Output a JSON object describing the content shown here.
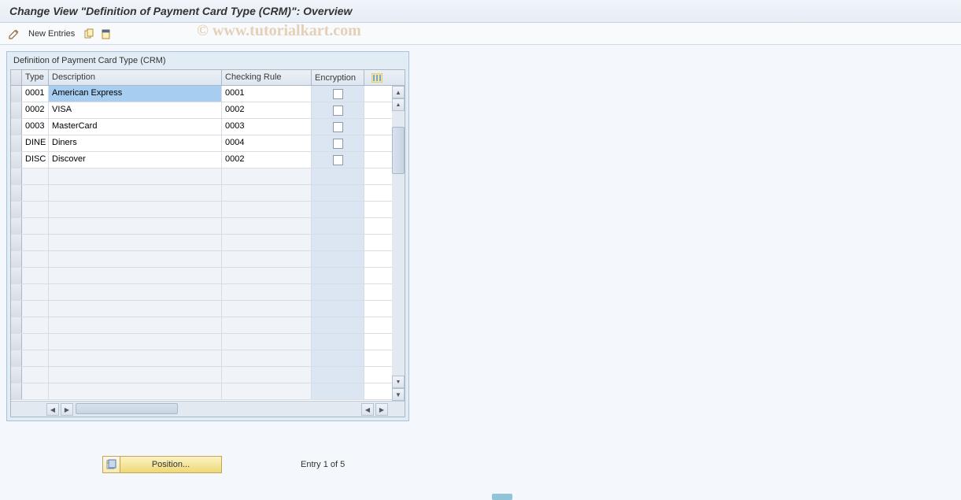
{
  "header": {
    "title": "Change View \"Definition of Payment Card Type (CRM)\": Overview"
  },
  "watermark": "© www.tutorialkart.com",
  "toolbar": {
    "new_entries_label": "New Entries"
  },
  "panel": {
    "title": "Definition of Payment Card Type (CRM)"
  },
  "columns": {
    "type": "Type",
    "description": "Description",
    "checking_rule": "Checking Rule",
    "encryption": "Encryption"
  },
  "rows": [
    {
      "type": "0001",
      "description": "American Express",
      "checking_rule": "0001",
      "encryption": false,
      "selected": true
    },
    {
      "type": "0002",
      "description": "VISA",
      "checking_rule": "0002",
      "encryption": false,
      "selected": false
    },
    {
      "type": "0003",
      "description": "MasterCard",
      "checking_rule": "0003",
      "encryption": false,
      "selected": false
    },
    {
      "type": "DINE",
      "description": "Diners",
      "checking_rule": "0004",
      "encryption": false,
      "selected": false
    },
    {
      "type": "DISC",
      "description": "Discover",
      "checking_rule": "0002",
      "encryption": false,
      "selected": false
    }
  ],
  "empty_row_count": 14,
  "footer": {
    "position_label": "Position...",
    "entry_status": "Entry 1 of 5"
  }
}
